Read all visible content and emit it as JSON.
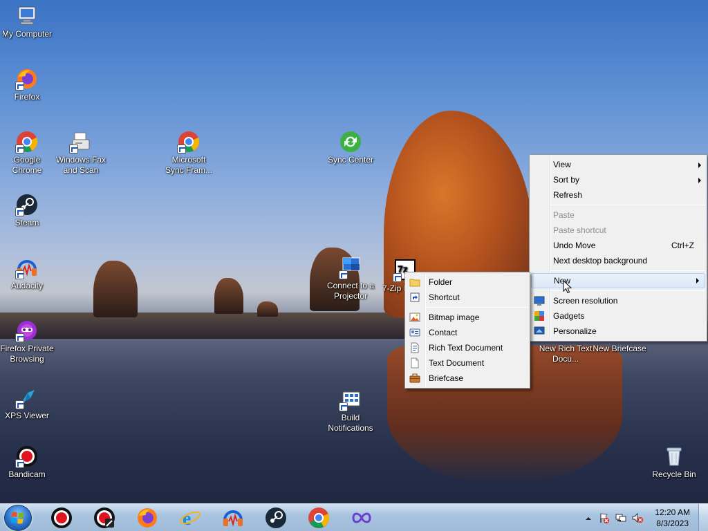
{
  "desktop_icons": {
    "my_computer": "My Computer",
    "firefox": "Firefox",
    "google_chrome": "Google Chrome",
    "windows_fax_scan": "Windows Fax and Scan",
    "microsoft_sync": "Microsoft Sync Fram...",
    "sync_center": "Sync Center",
    "steam": "Steam",
    "audacity": "Audacity",
    "connect_projector": "Connect to a Projector",
    "seven_zip": "7-Zip Man...",
    "firefox_private": "Firefox Private Browsing",
    "xps_viewer": "XPS Viewer",
    "build_notifications": "Build Notifications",
    "bandicam": "Bandicam",
    "new_rich_text": "New Rich Text Docu...",
    "new_briefcase": "New Briefcase",
    "recycle_bin": "Recycle Bin"
  },
  "context_menu": {
    "view": "View",
    "sort_by": "Sort by",
    "refresh": "Refresh",
    "paste": "Paste",
    "paste_shortcut": "Paste shortcut",
    "undo_move": "Undo Move",
    "undo_shortcut": "Ctrl+Z",
    "next_background": "Next desktop background",
    "new": "New",
    "screen_resolution": "Screen resolution",
    "gadgets": "Gadgets",
    "personalize": "Personalize"
  },
  "new_submenu": {
    "folder": "Folder",
    "shortcut": "Shortcut",
    "bitmap": "Bitmap image",
    "contact": "Contact",
    "rich_text": "Rich Text Document",
    "text_document": "Text Document",
    "briefcase": "Briefcase"
  },
  "taskbar": {
    "apps": [
      "bandicam-icon",
      "bandicam-settings-icon",
      "firefox-icon",
      "internet-explorer-icon",
      "audacity-icon",
      "steam-icon",
      "chrome-icon",
      "sync-icon"
    ],
    "time": "12:20 AM",
    "date": "8/3/2023"
  },
  "colors": {
    "menu_bg": "#f0f0f0",
    "menu_border": "#979797",
    "hover_bg": "#dbe8f8",
    "taskbar": "#a8c4e0"
  }
}
